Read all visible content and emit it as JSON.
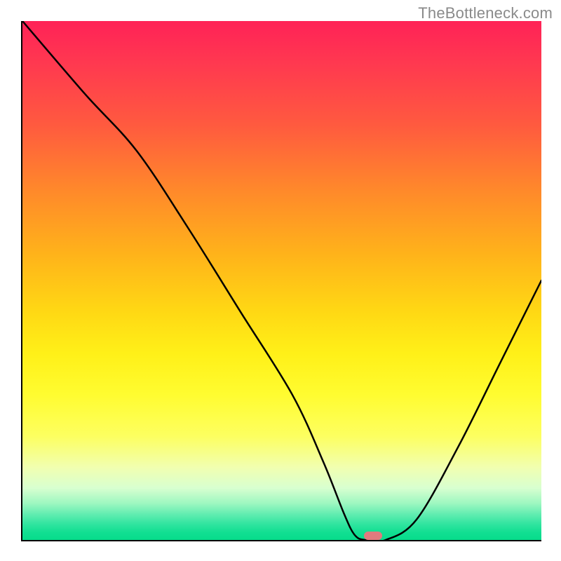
{
  "watermark": "TheBottleneck.com",
  "chart_data": {
    "type": "line",
    "title": "",
    "xlabel": "",
    "ylabel": "",
    "xlim": [
      0,
      100
    ],
    "ylim": [
      0,
      100
    ],
    "grid": false,
    "legend": false,
    "series": [
      {
        "name": "curve",
        "x": [
          0,
          12,
          22,
          32,
          42,
          52,
          58,
          62,
          64,
          66,
          70,
          76,
          84,
          92,
          100
        ],
        "y": [
          100,
          86,
          75,
          60,
          44,
          28,
          15,
          5,
          1,
          0,
          0,
          4,
          18,
          34,
          50
        ]
      }
    ],
    "marker": {
      "x": 67.5,
      "y": 0.8
    },
    "gradient_stops": [
      {
        "pct_from_top": 0,
        "color": "#ff2257"
      },
      {
        "pct_from_top": 20,
        "color": "#ff5a3f"
      },
      {
        "pct_from_top": 45,
        "color": "#ffb31a"
      },
      {
        "pct_from_top": 72,
        "color": "#fffc30"
      },
      {
        "pct_from_top": 90,
        "color": "#d8ffd0"
      },
      {
        "pct_from_top": 100,
        "color": "#06dc8b"
      }
    ]
  }
}
